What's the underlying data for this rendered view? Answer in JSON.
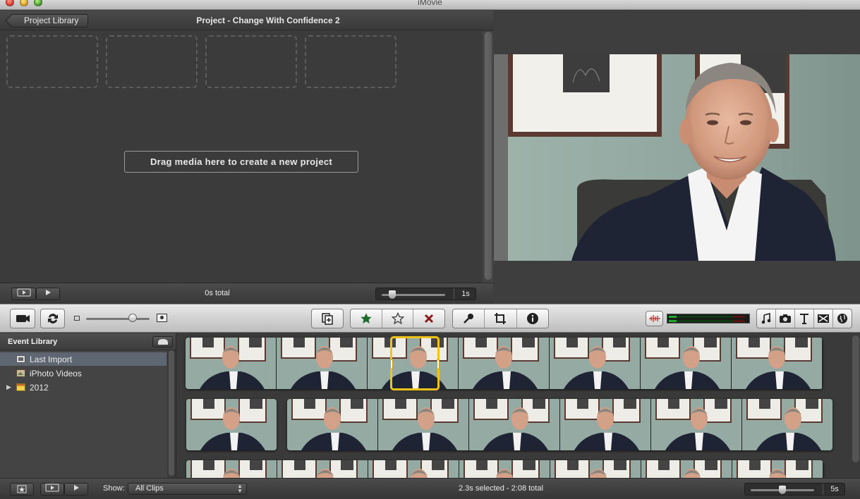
{
  "app": {
    "title": "iMovie"
  },
  "project": {
    "library_button": "Project Library",
    "title": "Project - Change With Confidence 2",
    "drag_hint": "Drag media here to create a new project",
    "total": "0s total",
    "zoom_label": "1s"
  },
  "event_library": {
    "header": "Event Library",
    "items": [
      {
        "label": "Last Import",
        "icon": "film-icon",
        "selected": true
      },
      {
        "label": "iPhoto Videos",
        "icon": "iphoto-icon",
        "selected": false
      },
      {
        "label": "2012",
        "icon": "calendar-icon",
        "selected": false,
        "collapsed": true
      }
    ]
  },
  "toolbar": {
    "left_buttons": [
      "camera-import-icon",
      "swap-icon"
    ],
    "rating_buttons": [
      "favorite-star-icon",
      "unmark-star-icon",
      "reject-x-icon"
    ],
    "tool_buttons": [
      "microphone-icon",
      "crop-icon",
      "info-icon"
    ],
    "browser_buttons": [
      "music-icon",
      "photo-camera-icon",
      "title-text-icon",
      "transition-icon",
      "map-globe-icon"
    ]
  },
  "bottom_bar": {
    "show_label": "Show:",
    "show_value": "All Clips",
    "status": "2.3s selected - 2:08 total",
    "zoom_label": "5s"
  },
  "colors": {
    "selection_yellow": "#f0c419",
    "meter_green": "#22a832",
    "panel_dark": "#3b3b3b"
  }
}
